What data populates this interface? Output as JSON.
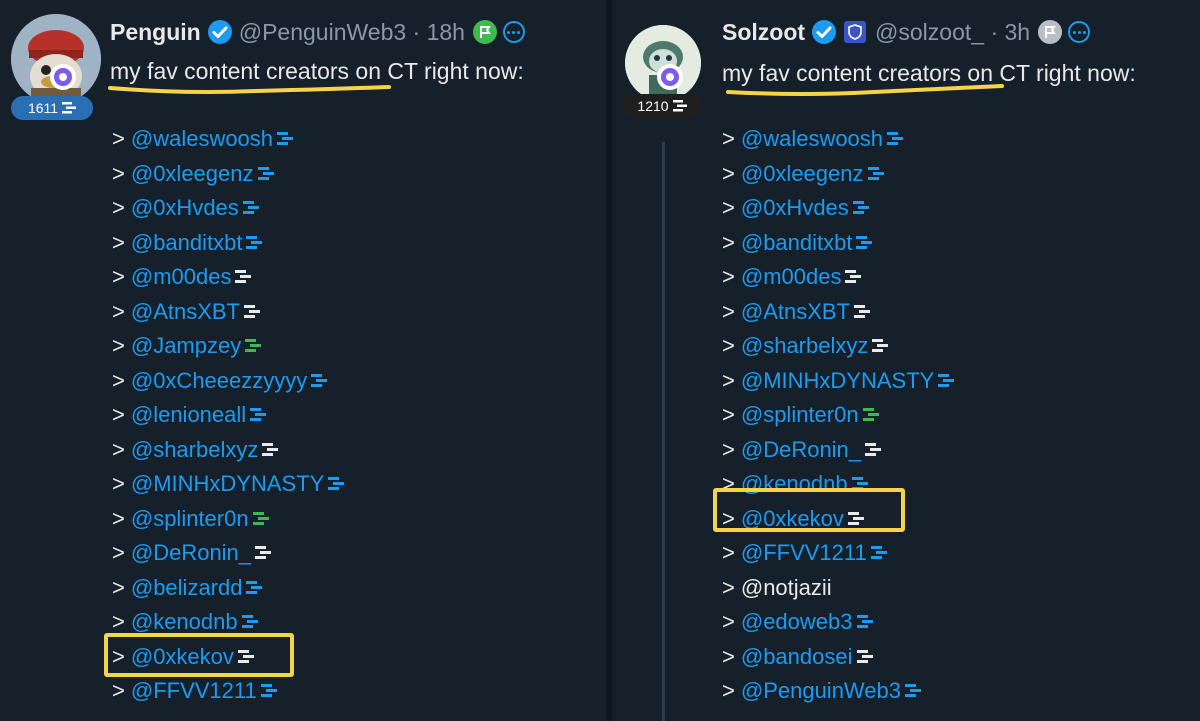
{
  "left_tweet": {
    "display_name": "Penguin",
    "handle_time": "@PenguinWeb3 · 18h",
    "score": "1611",
    "text": "my fav content creators on CT right now:",
    "mentions": [
      {
        "text": "@waleswoosh",
        "tag_color": "#1d9bf0"
      },
      {
        "text": "@0xleegenz",
        "tag_color": "#1d9bf0"
      },
      {
        "text": "@0xHvdes",
        "tag_color": "#1d9bf0"
      },
      {
        "text": "@banditxbt",
        "tag_color": "#1d9bf0"
      },
      {
        "text": "@m00des",
        "tag_color": "#e7e9ea"
      },
      {
        "text": "@AtnsXBT",
        "tag_color": "#e7e9ea"
      },
      {
        "text": "@Jampzey",
        "tag_color": "#3fb950"
      },
      {
        "text": "@0xCheeezzyyyy",
        "tag_color": "#1d9bf0"
      },
      {
        "text": "@lenioneall",
        "tag_color": "#1d9bf0"
      },
      {
        "text": "@sharbelxyz",
        "tag_color": "#e7e9ea"
      },
      {
        "text": "@MINHxDYNASTY",
        "tag_color": "#1d9bf0"
      },
      {
        "text": "@splinter0n",
        "tag_color": "#3fb950"
      },
      {
        "text": "@DeRonin_",
        "tag_color": "#e7e9ea"
      },
      {
        "text": "@belizardd",
        "tag_color": "#1d9bf0"
      },
      {
        "text": "@kenodnb",
        "tag_color": "#1d9bf0"
      },
      {
        "text": "@0xkekov",
        "tag_color": "#e7e9ea"
      },
      {
        "text": "@FFVV1211",
        "tag_color": "#1d9bf0"
      }
    ]
  },
  "right_tweet": {
    "display_name": "Solzoot",
    "handle_time": "@solzoot_ · 3h",
    "score": "1210",
    "text": "my fav content creators on CT right now:",
    "mentions": [
      {
        "text": "@waleswoosh",
        "tag_color": "#1d9bf0",
        "style": "link"
      },
      {
        "text": "@0xleegenz",
        "tag_color": "#1d9bf0",
        "style": "link"
      },
      {
        "text": "@0xHvdes",
        "tag_color": "#1d9bf0",
        "style": "link"
      },
      {
        "text": "@banditxbt",
        "tag_color": "#1d9bf0",
        "style": "link"
      },
      {
        "text": "@m00des",
        "tag_color": "#e7e9ea",
        "style": "link"
      },
      {
        "text": "@AtnsXBT",
        "tag_color": "#e7e9ea",
        "style": "link"
      },
      {
        "text": "@sharbelxyz",
        "tag_color": "#e7e9ea",
        "style": "link"
      },
      {
        "text": "@MINHxDYNASTY",
        "tag_color": "#1d9bf0",
        "style": "link"
      },
      {
        "text": "@splinter0n",
        "tag_color": "#3fb950",
        "style": "link"
      },
      {
        "text": "@DeRonin_",
        "tag_color": "#e7e9ea",
        "style": "link"
      },
      {
        "text": "@kenodnb",
        "tag_color": "#1d9bf0",
        "style": "link"
      },
      {
        "text": "@0xkekov",
        "tag_color": "#e7e9ea",
        "style": "link"
      },
      {
        "text": "@FFVV1211",
        "tag_color": "#1d9bf0",
        "style": "link"
      },
      {
        "text": "@notjazii",
        "tag_color": "",
        "style": "plain"
      },
      {
        "text": "@edoweb3",
        "tag_color": "#1d9bf0",
        "style": "link"
      },
      {
        "text": "@bandosei",
        "tag_color": "#e7e9ea",
        "style": "link"
      },
      {
        "text": "@PenguinWeb3",
        "tag_color": "#1d9bf0",
        "style": "link"
      }
    ]
  },
  "colors": {
    "background": "#15202b",
    "link_blue": "#1d9bf0",
    "highlight_yellow": "#f5d547",
    "muted_gray": "#8b98a5"
  },
  "icons": {
    "verified": "verified-check-icon",
    "flag": "flag-icon",
    "more": "more-options-icon",
    "score_tag": "stacked-bars-icon",
    "affiliate_badge": "shield-badge-icon"
  }
}
